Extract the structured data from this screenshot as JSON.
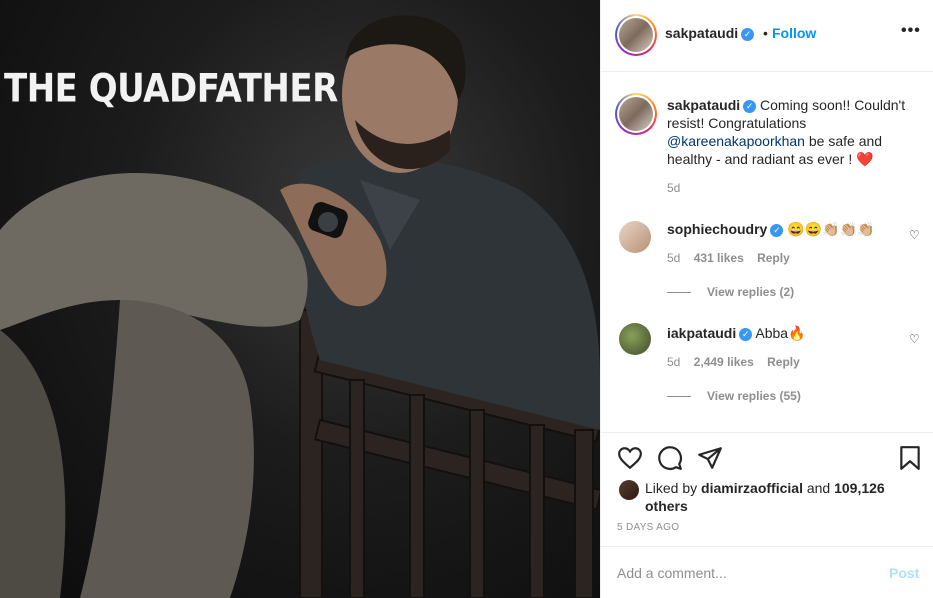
{
  "photo": {
    "overlay_text": "THE QUADFATHER"
  },
  "header": {
    "username": "sakpataudi",
    "separator": "•",
    "follow_label": "Follow",
    "more_label": "•••"
  },
  "caption": {
    "username": "sakpataudi",
    "text_before": "Coming soon!! Couldn't resist! Congratulations",
    "mention": "@kareenakapoorkhan",
    "text_after": "be safe and healthy - and radiant as ever ! ❤️",
    "age": "5d"
  },
  "comments": [
    {
      "username": "sophiechoudry",
      "text": "😄😄👏🏼👏🏼👏🏼",
      "age": "5d",
      "likes": "431 likes",
      "reply_label": "Reply",
      "view_replies": "View replies (2)"
    },
    {
      "username": "iakpataudi",
      "text": "Abba🔥",
      "age": "5d",
      "likes": "2,449 likes",
      "reply_label": "Reply",
      "view_replies": "View replies (55)"
    }
  ],
  "likes": {
    "prefix": "Liked by",
    "user": "diamirzaofficial",
    "middle": "and",
    "others": "109,126 others"
  },
  "posted_ago": "5 DAYS AGO",
  "add_comment": {
    "placeholder": "Add a comment...",
    "post_label": "Post"
  },
  "colors": {
    "link": "#0095f6",
    "verified": "#3897f0",
    "muted": "#8e8e8e"
  }
}
